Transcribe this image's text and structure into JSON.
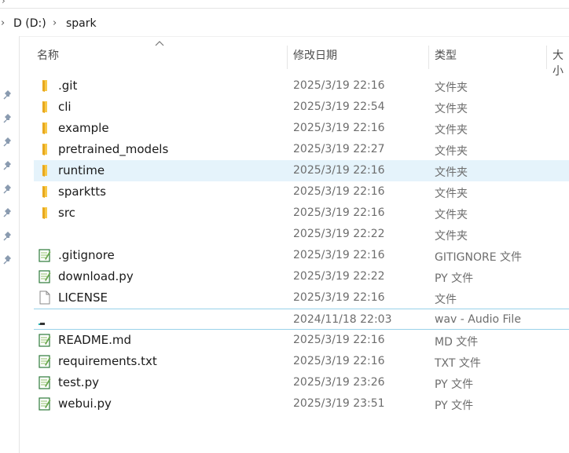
{
  "breadcrumb": {
    "drive": "D (D:)",
    "folder": "spark"
  },
  "columns": {
    "name": "名称",
    "modified": "修改日期",
    "type": "类型",
    "size": "大小"
  },
  "files": [
    {
      "name": ".git",
      "modified": "2025/3/19 22:16",
      "type": "文件夹",
      "icon": "folder-icon"
    },
    {
      "name": "cli",
      "modified": "2025/3/19 22:54",
      "type": "文件夹",
      "icon": "folder-icon"
    },
    {
      "name": "example",
      "modified": "2025/3/19 22:16",
      "type": "文件夹",
      "icon": "folder-icon"
    },
    {
      "name": "pretrained_models",
      "modified": "2025/3/19 22:27",
      "type": "文件夹",
      "icon": "folder-icon"
    },
    {
      "name": "runtime",
      "modified": "2025/3/19 22:16",
      "type": "文件夹",
      "icon": "folder-icon"
    },
    {
      "name": "sparktts",
      "modified": "2025/3/19 22:16",
      "type": "文件夹",
      "icon": "folder-icon"
    },
    {
      "name": "src",
      "modified": "2025/3/19 22:16",
      "type": "文件夹",
      "icon": "folder-icon"
    },
    {
      "name": "",
      "modified": "2025/3/19 22:22",
      "type": "文件夹",
      "icon": "none"
    },
    {
      "name": ".gitignore",
      "modified": "2025/3/19 22:16",
      "type": "GITIGNORE 文件",
      "icon": "notepad-icon"
    },
    {
      "name": "download.py",
      "modified": "2025/3/19 22:22",
      "type": "PY 文件",
      "icon": "notepad-icon"
    },
    {
      "name": "LICENSE",
      "modified": "2025/3/19 22:16",
      "type": "文件",
      "icon": "blank-file-icon"
    },
    {
      "name": "",
      "modified": "2024/11/18 22:03",
      "type": "wav - Audio File",
      "icon": "audio-file-icon"
    },
    {
      "name": "README.md",
      "modified": "2025/3/19 22:16",
      "type": "MD 文件",
      "icon": "notepad-icon"
    },
    {
      "name": "requirements.txt",
      "modified": "2025/3/19 22:16",
      "type": "TXT 文件",
      "icon": "notepad-icon"
    },
    {
      "name": "test.py",
      "modified": "2025/3/19 23:26",
      "type": "PY 文件",
      "icon": "notepad-icon"
    },
    {
      "name": "webui.py",
      "modified": "2025/3/19 23:51",
      "type": "PY 文件",
      "icon": "notepad-icon"
    }
  ],
  "hover_row": 4,
  "outlined_row": 11,
  "sort_icon": "sort-ascending-caret-icon",
  "pin_icon": "pin-icon",
  "accent_colors": {
    "folder": "#f7c948",
    "hover": "#e5f3fb",
    "selection_border": "#99d1ea"
  }
}
